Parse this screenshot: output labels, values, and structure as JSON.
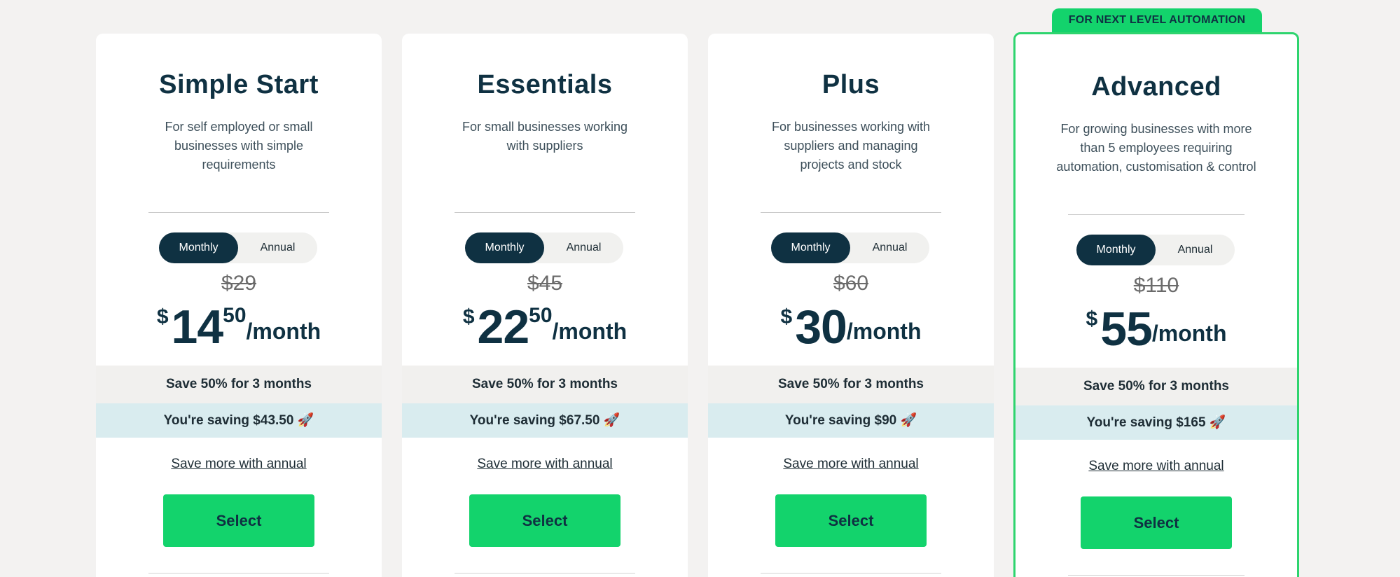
{
  "featured_banner": "FOR NEXT LEVEL AUTOMATION",
  "toggle": {
    "monthly_label": "Monthly",
    "annual_label": "Annual"
  },
  "plans": [
    {
      "name": "Simple Start",
      "description": "For self employed or small businesses with simple requirements",
      "old_price": "$29",
      "currency": "$",
      "price_whole": "14",
      "price_cents": "50",
      "per": "/month",
      "promo": "Save 50% for 3 months",
      "saving": "You're saving $43.50 🚀",
      "annual_link": "Save more with annual",
      "select_label": "Select"
    },
    {
      "name": "Essentials",
      "description": "For small businesses working with suppliers",
      "old_price": "$45",
      "currency": "$",
      "price_whole": "22",
      "price_cents": "50",
      "per": "/month",
      "promo": "Save 50% for 3 months",
      "saving": "You're saving $67.50 🚀",
      "annual_link": "Save more with annual",
      "select_label": "Select"
    },
    {
      "name": "Plus",
      "description": "For businesses working with suppliers and managing projects and stock",
      "old_price": "$60",
      "currency": "$",
      "price_whole": "30",
      "price_cents": "",
      "per": "/month",
      "promo": "Save 50% for 3 months",
      "saving": "You're saving $90 🚀",
      "annual_link": "Save more with annual",
      "select_label": "Select"
    },
    {
      "name": "Advanced",
      "description": "For growing businesses with more than 5 employees requiring automation, customisation & control",
      "old_price": "$110",
      "currency": "$",
      "price_whole": "55",
      "price_cents": "",
      "per": "/month",
      "promo": "Save 50% for 3 months",
      "saving": "You're saving $165 🚀",
      "annual_link": "Save more with annual",
      "select_label": "Select"
    }
  ],
  "colors": {
    "brand_green": "#13d36c",
    "navy": "#0f3142",
    "promo_strip": "#f1f0ee",
    "saving_strip": "#d9ecef"
  }
}
